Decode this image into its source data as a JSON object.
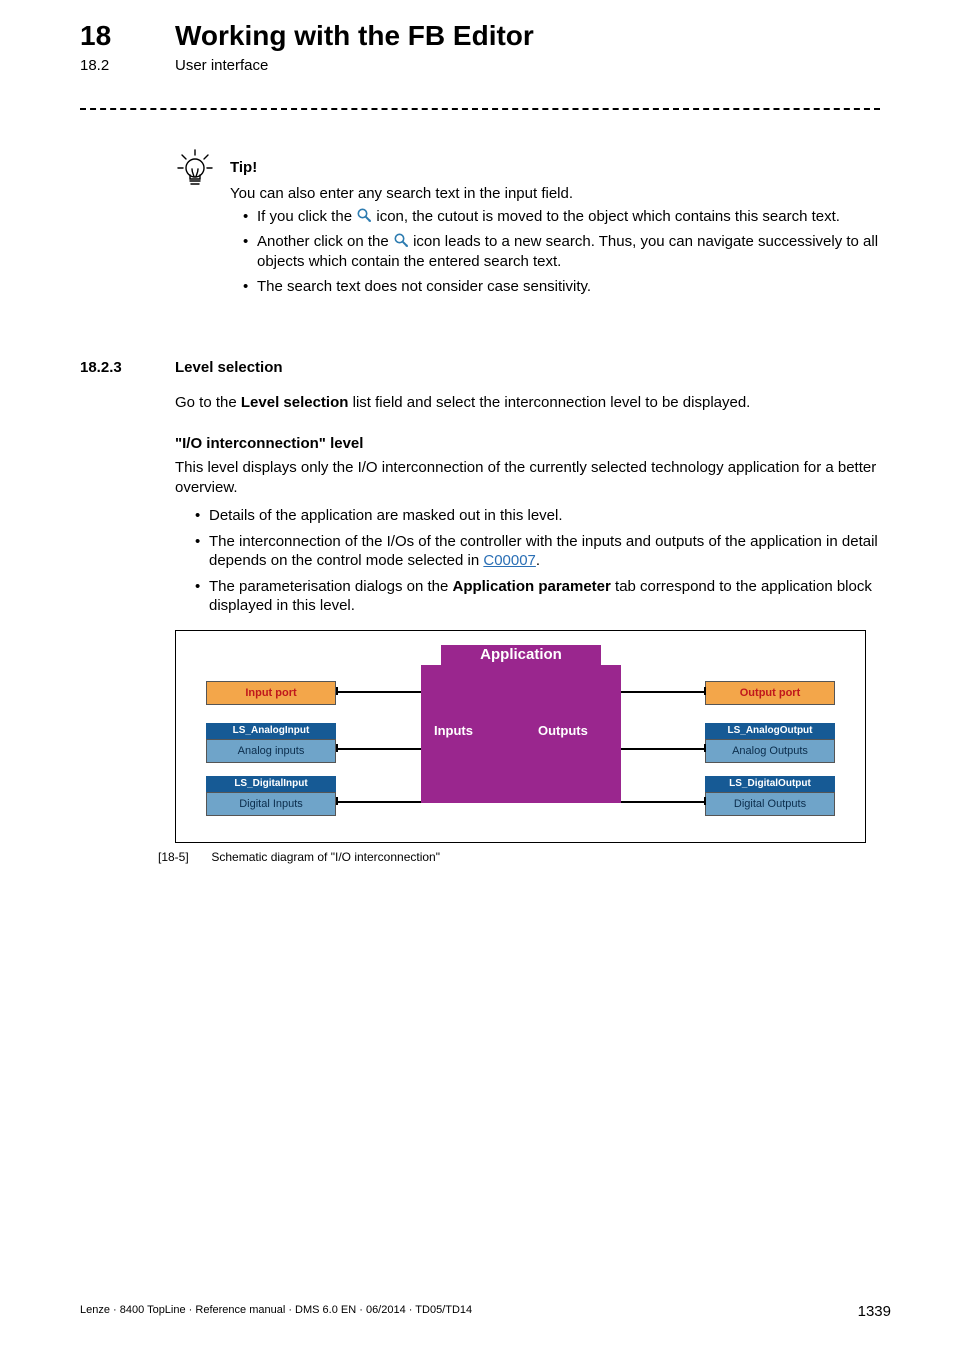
{
  "header": {
    "chapter_number": "18",
    "chapter_title": "Working with the FB Editor",
    "section_number": "18.2",
    "section_title": "User interface"
  },
  "tip": {
    "label": "Tip!",
    "intro": "You can also enter any search text in the input field.",
    "bullets": {
      "b1a": "If you click the ",
      "b1b": " icon, the cutout is moved to the object which contains this search text.",
      "b2a": "Another click on the ",
      "b2b": " icon leads to a new search. Thus, you can navigate successively to all objects which contain the entered search text.",
      "b3": "The search text does not consider case sensitivity."
    }
  },
  "section": {
    "number": "18.2.3",
    "title": "Level selection",
    "intro_a": "Go to the ",
    "intro_b": "Level selection",
    "intro_c": " list field and select the interconnection level to be displayed.",
    "sub_head": "\"I/O interconnection\" level",
    "para": "This level displays only the I/O interconnection of the currently selected technology application for a better overview.",
    "bullets": {
      "b1": "Details of the application are masked out in this level.",
      "b2a": "The interconnection of the I/Os of the controller with the inputs and outputs of the application in detail depends on the control mode selected in ",
      "b2_link": "C00007",
      "b2b": ".",
      "b3a": "The parameterisation dialogs on the ",
      "b3_bold": "Application parameter",
      "b3b": " tab correspond to the application block displayed in this level."
    }
  },
  "diagram": {
    "app_label": "Application",
    "inputs_label": "Inputs",
    "outputs_label": "Outputs",
    "input_port": "Input port",
    "output_port": "Output port",
    "ls_analog_input_hdr": "LS_AnalogInput",
    "ls_analog_input": "Analog inputs",
    "ls_digital_input_hdr": "LS_DigitalInput",
    "ls_digital_input": "Digital Inputs",
    "ls_analog_output_hdr": "LS_AnalogOutput",
    "ls_analog_output": "Analog Outputs",
    "ls_digital_output_hdr": "LS_DigitalOutput",
    "ls_digital_output": "Digital Outputs"
  },
  "caption": {
    "idx": "[18-5]",
    "text": "Schematic diagram of \"I/O interconnection\""
  },
  "footer": {
    "left": "Lenze · 8400 TopLine · Reference manual · DMS 6.0 EN · 06/2014 · TD05/TD14",
    "right": "1339"
  }
}
